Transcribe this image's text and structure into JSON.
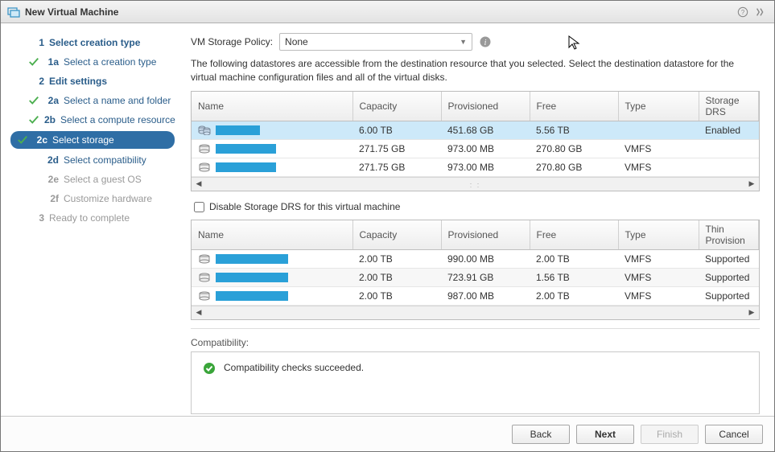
{
  "title": "New Virtual Machine",
  "sidebar": {
    "s1": {
      "num": "1",
      "label": "Select creation type"
    },
    "s1a": {
      "num": "1a",
      "label": "Select a creation type"
    },
    "s2": {
      "num": "2",
      "label": "Edit settings"
    },
    "s2a": {
      "num": "2a",
      "label": "Select a name and folder"
    },
    "s2b": {
      "num": "2b",
      "label": "Select a compute resource"
    },
    "s2c": {
      "num": "2c",
      "label": "Select storage"
    },
    "s2d": {
      "num": "2d",
      "label": "Select compatibility"
    },
    "s2e": {
      "num": "2e",
      "label": "Select a guest OS"
    },
    "s2f": {
      "num": "2f",
      "label": "Customize hardware"
    },
    "s3": {
      "num": "3",
      "label": "Ready to complete"
    }
  },
  "policy": {
    "label": "VM Storage Policy:",
    "value": "None"
  },
  "desc": "The following datastores are accessible from the destination resource that you selected. Select the destination datastore for the virtual machine configuration files and all of the virtual disks.",
  "table1": {
    "headers": {
      "name": "Name",
      "capacity": "Capacity",
      "provisioned": "Provisioned",
      "free": "Free",
      "type": "Type",
      "drs": "Storage DRS"
    },
    "rows": [
      {
        "capacity": "6.00 TB",
        "provisioned": "451.68 GB",
        "free": "5.56 TB",
        "type": "",
        "drs": "Enabled"
      },
      {
        "capacity": "271.75 GB",
        "provisioned": "973.00 MB",
        "free": "270.80 GB",
        "type": "VMFS",
        "drs": ""
      },
      {
        "capacity": "271.75 GB",
        "provisioned": "973.00 MB",
        "free": "270.80 GB",
        "type": "VMFS",
        "drs": ""
      }
    ]
  },
  "disableDrsLabel": "Disable Storage DRS for this virtual machine",
  "table2": {
    "headers": {
      "name": "Name",
      "capacity": "Capacity",
      "provisioned": "Provisioned",
      "free": "Free",
      "type": "Type",
      "thin": "Thin Provision"
    },
    "rows": [
      {
        "capacity": "2.00 TB",
        "provisioned": "990.00 MB",
        "free": "2.00 TB",
        "type": "VMFS",
        "thin": "Supported"
      },
      {
        "capacity": "2.00 TB",
        "provisioned": "723.91 GB",
        "free": "1.56 TB",
        "type": "VMFS",
        "thin": "Supported"
      },
      {
        "capacity": "2.00 TB",
        "provisioned": "987.00 MB",
        "free": "2.00 TB",
        "type": "VMFS",
        "thin": "Supported"
      }
    ]
  },
  "compat": {
    "label": "Compatibility:",
    "message": "Compatibility checks succeeded."
  },
  "buttons": {
    "back": "Back",
    "next": "Next",
    "finish": "Finish",
    "cancel": "Cancel"
  }
}
